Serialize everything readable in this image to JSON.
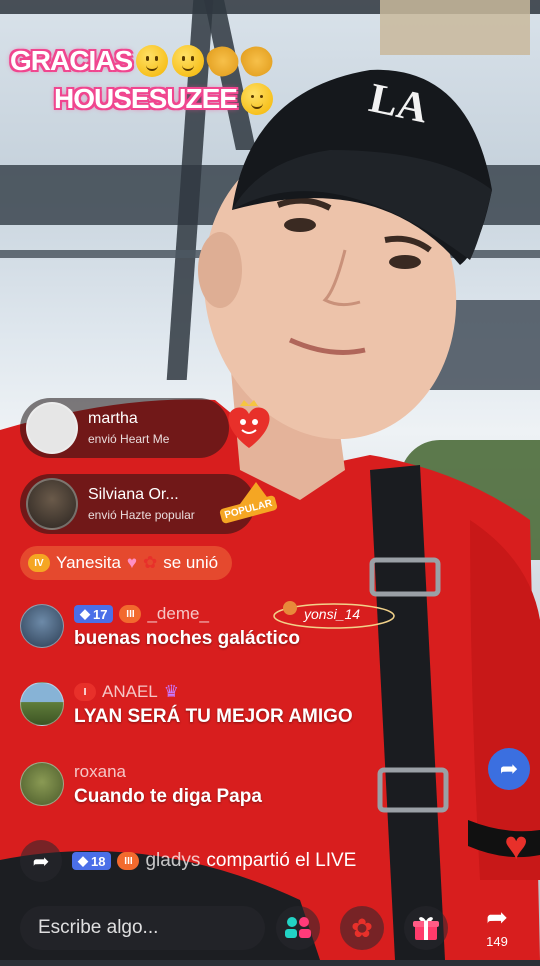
{
  "overlay": {
    "line1": "GRACIAS",
    "line2": "HOUSESUZEE"
  },
  "gift_notifications": [
    {
      "name": "martha",
      "action": "envió Heart Me"
    },
    {
      "name": "Silviana Or...",
      "action": "envió Hazte popular",
      "gift_label": "POPULAR"
    }
  ],
  "joined": {
    "level": "IV",
    "user": "Yanesita",
    "text": "se unió"
  },
  "watermark": {
    "text": "yonsi_14"
  },
  "chat": [
    {
      "level": "17",
      "fan_badge": "III",
      "name": "_deme_",
      "message": "buenas noches galáctico"
    },
    {
      "fan_badge": "I",
      "name": "ANAEL",
      "message": "LYAN SERÁ TU MEJOR AMIGO"
    },
    {
      "name": "roxana",
      "message": "Cuando te diga Papa"
    }
  ],
  "share_event": {
    "level": "18",
    "fan_badge": "III",
    "name": "gladys",
    "text": "compartió el LIVE"
  },
  "bottom": {
    "input_placeholder": "Escribe algo...",
    "share_count": "149"
  },
  "icons": [
    "share-arrow-icon",
    "multi-guest-icon",
    "rose-icon",
    "gift-icon",
    "forward-icon",
    "heart-icon"
  ],
  "colors": {
    "title_outline": "#f0468f",
    "level_badge": "#4b6fe8",
    "fan_badge": "#f26a2e",
    "shirt": "#d81e1e"
  }
}
